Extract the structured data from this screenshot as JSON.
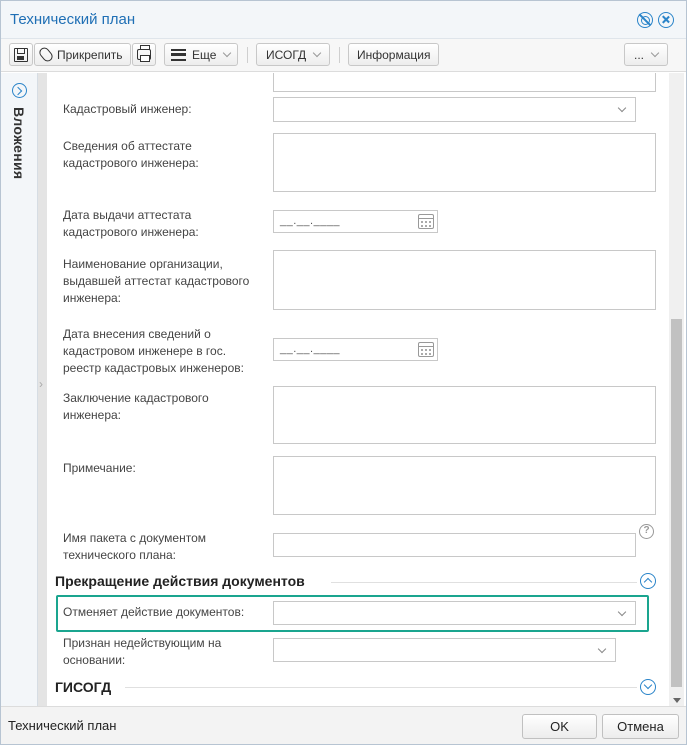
{
  "window": {
    "title": "Технический план"
  },
  "toolbar": {
    "attach_label": "Прикрепить",
    "more_label": "Еще",
    "isogd_label": "ИСОГД",
    "info_label": "Информация",
    "overflow_label": "..."
  },
  "side_panel": {
    "label": "Вложения"
  },
  "fields": {
    "cadastral_engineer": {
      "label": "Кадастровый инженер:",
      "value": ""
    },
    "attestat_info": {
      "label": "Сведения об аттестате кадастрового инженера:",
      "value": ""
    },
    "attestat_date": {
      "label": "Дата выдачи аттестата кадастрового инженера:",
      "mask": "__.__.____"
    },
    "issuing_org": {
      "label": "Наименование организации, выдавшей аттестат кадастрового инженера:",
      "value": ""
    },
    "registry_date": {
      "label": "Дата внесения сведений о кадастровом инженере в гос. реестр кадастровых инженеров:",
      "mask": "__.__.____"
    },
    "conclusion": {
      "label": "Заключение кадастрового инженера:",
      "value": ""
    },
    "note": {
      "label": "Примечание:",
      "value": ""
    },
    "package_name": {
      "label": "Имя пакета с документом технического плана:",
      "value": ""
    }
  },
  "sections": {
    "termination": {
      "title": "Прекращение действия документов",
      "cancels_docs": {
        "label": "Отменяет действие документов:",
        "value": ""
      },
      "invalid_basis": {
        "label": "Признан недействующим на основании:",
        "value": ""
      }
    },
    "gisogd": {
      "title": "ГИСОГД"
    }
  },
  "footer": {
    "status": "Технический план",
    "ok_label": "OK",
    "cancel_label": "Отмена"
  },
  "colors": {
    "accent": "#1f6fb5",
    "highlight": "#1aa58f"
  }
}
